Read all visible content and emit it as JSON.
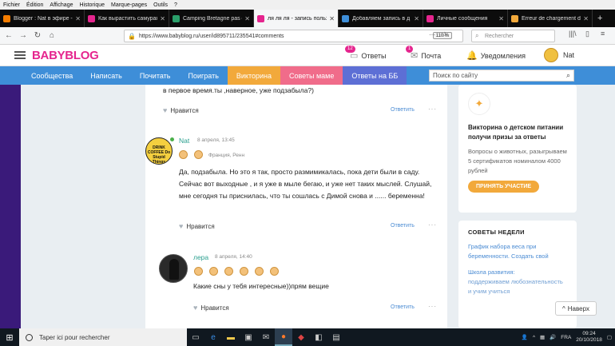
{
  "menubar": [
    "Fichier",
    "Édition",
    "Affichage",
    "Historique",
    "Marque-pages",
    "Outils",
    "?"
  ],
  "tabs": [
    {
      "title": "Blogger : Nat в эфире -",
      "color": "#f57d00",
      "active": false
    },
    {
      "title": "Как вырастить самурая",
      "color": "#e5258e",
      "active": false
    },
    {
      "title": "Camping Bretagne pas c",
      "color": "#2a9f6a",
      "active": false
    },
    {
      "title": "ля ля ля - запись польз",
      "color": "#e5258e",
      "active": true
    },
    {
      "title": "Добавляем запись в д",
      "color": "#3e8ed8",
      "active": false
    },
    {
      "title": "Личные сообщения",
      "color": "#e5258e",
      "active": false
    },
    {
      "title": "Erreur de chargement de",
      "color": "#f2a93b",
      "active": false
    }
  ],
  "navbar": {
    "url": "https://www.babyblog.ru/user/id895711/235541#comments",
    "zoom": "110 %",
    "search_placeholder": "Rechercher"
  },
  "header": {
    "logo": "BABYBLOG",
    "answers_label": "Ответы",
    "answers_badge": "12",
    "mail_label": "Почта",
    "mail_badge": "1",
    "notif_label": "Уведомления",
    "user_name": "Nat"
  },
  "bluenav": {
    "items": [
      "Сообщества",
      "Написать",
      "Почитать",
      "Поиграть",
      "Викторина",
      "Советы маме",
      "Ответы на ББ"
    ],
    "search_placeholder": "Поиск по сайту"
  },
  "comments": {
    "prev_text": "в первое время.ты ,наверное, уже подзабыла?)",
    "like_label": "Нравится",
    "reply_label": "Ответить",
    "c1": {
      "author": "Nat",
      "date": "8 апреля, 13:45",
      "city": "Франция, Ренн",
      "avatar_text": "DRINK COFFEE Do Stupid Things Faster With More Energy",
      "text": "Да, подзабыла. Но это я так, просто размимикалась, пока дети были в саду. Сейчас вот выходные , и я уже в мыле бегаю, и уже нет таких мыслей. Слушай, мне сегодня ты приснилась, что ты сошлась с Димой снова и ...... беременна!"
    },
    "c2": {
      "author": "лера",
      "date": "8 апреля, 14:40",
      "text": "Какие сны у тебя интересные))прям вещие"
    }
  },
  "sidebar": {
    "quiz_title": "Викторина о детском питании получи призы за ответы",
    "quiz_sub": "Вопросы о животных, разыгрываем 5 сертификатов номиналом 4000 рублей",
    "quiz_button": "ПРИНЯТЬ УЧАСТИЕ",
    "advice_heading": "СОВЕТЫ НЕДЕЛИ",
    "advice_link": "График набора веса при беременности. Создать свой",
    "advice2_title": "Школа развития:",
    "advice2_text": "поддерживаем любознательность и учим учиться",
    "back_top": "Наверх"
  },
  "taskbar": {
    "search_placeholder": "Taper ici pour rechercher",
    "lang": "FRA",
    "time": "09:24",
    "date": "20/10/2018"
  }
}
